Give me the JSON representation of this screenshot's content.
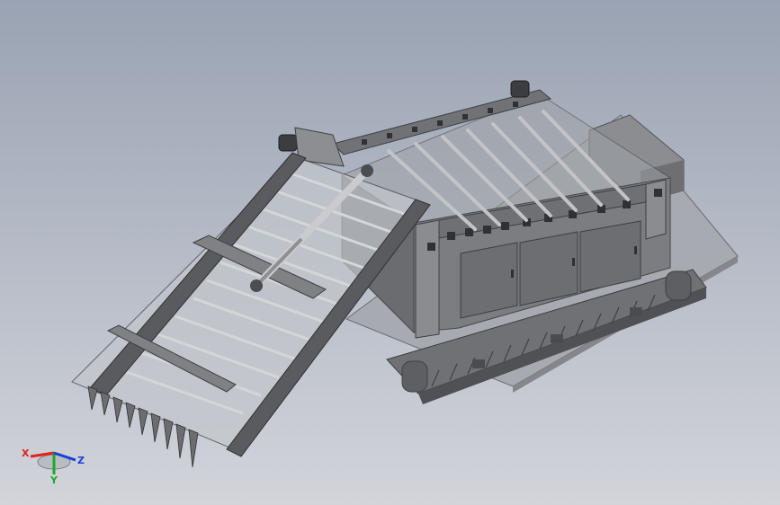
{
  "viewport": {
    "background_top": "#9aa3b3",
    "background_bottom": "#d2d4da"
  },
  "model": {
    "body_color": "#7c7d80",
    "body_dark": "#55575b",
    "body_light": "#a4a6aa",
    "rail_color": "#3d3f43",
    "roller_color": "#c7c9cd",
    "shadow_color": "#9ca0a8"
  },
  "triad": {
    "x_label": "X",
    "y_label": "Y",
    "z_label": "Z",
    "x_color": "#e0221c",
    "y_color": "#1fa82a",
    "z_color": "#1a3fd6",
    "icon": "coordinate-triad-icon"
  }
}
